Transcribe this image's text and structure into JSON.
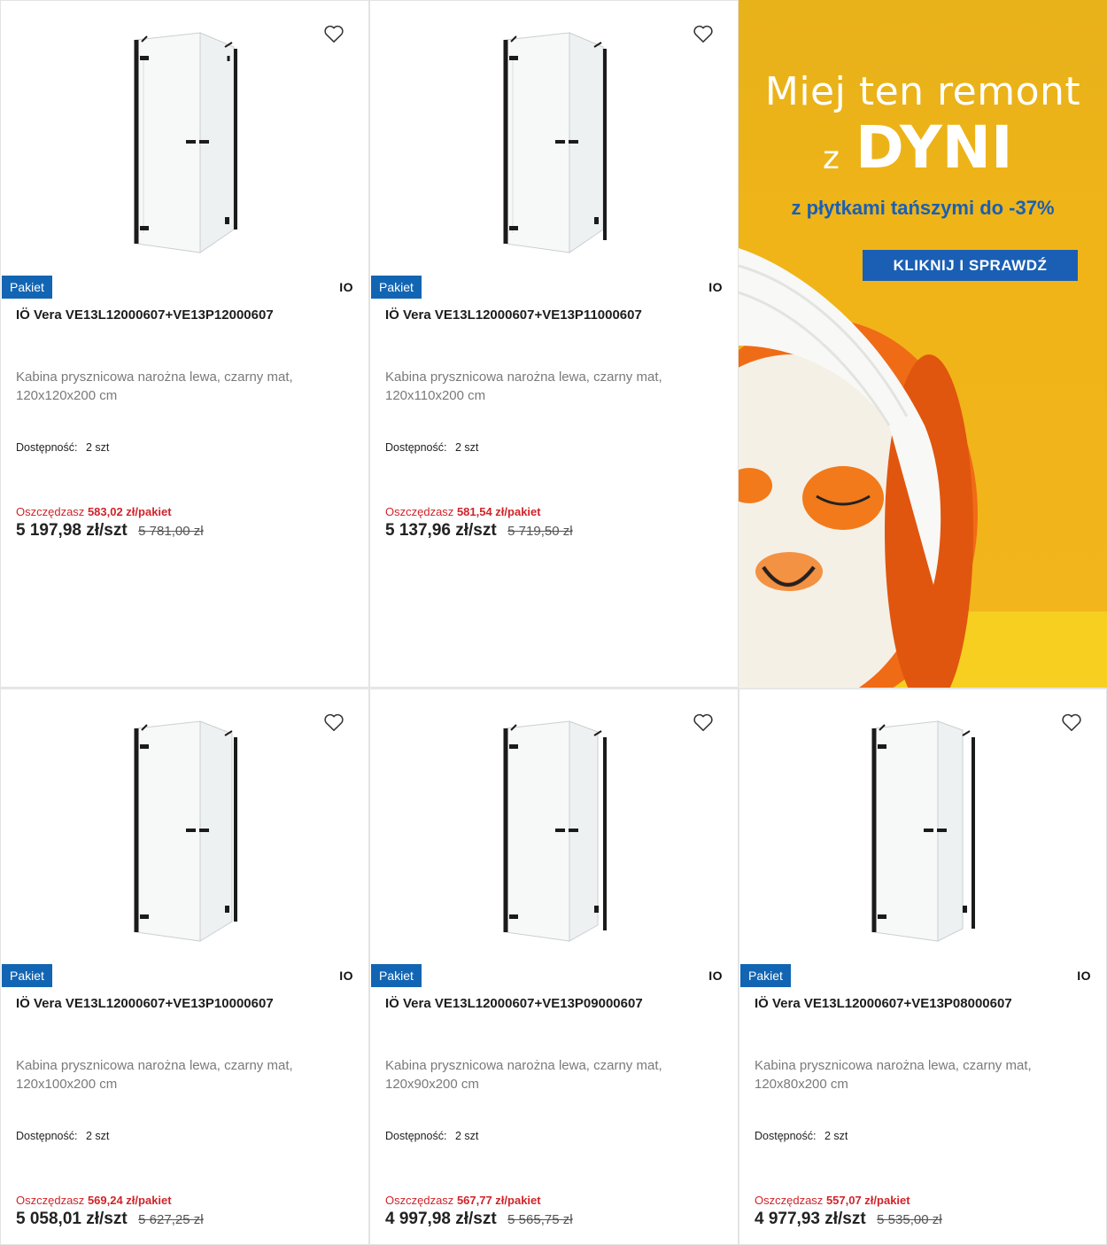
{
  "products": [
    {
      "badge": "Pakiet",
      "brand": "IO",
      "title": "IÖ Vera VE13L12000607+VE13P12000607",
      "description": "Kabina prysznicowa narożna lewa, czarny mat, 120x120x200 cm",
      "availability_label": "Dostępność:",
      "availability_value": "2 szt",
      "save_label": "Oszczędzasz",
      "save_amount": "583,02 zł/pakiet",
      "price": "5 197,98 zł/szt",
      "old_price": "5 781,00 zł"
    },
    {
      "badge": "Pakiet",
      "brand": "IO",
      "title": "IÖ Vera VE13L12000607+VE13P11000607",
      "description": "Kabina prysznicowa narożna lewa, czarny mat, 120x110x200 cm",
      "availability_label": "Dostępność:",
      "availability_value": "2 szt",
      "save_label": "Oszczędzasz",
      "save_amount": "581,54 zł/pakiet",
      "price": "5 137,96 zł/szt",
      "old_price": "5 719,50 zł"
    },
    {
      "badge": "Pakiet",
      "brand": "IO",
      "title": "IÖ Vera VE13L12000607+VE13P10000607",
      "description": "Kabina prysznicowa narożna lewa, czarny mat, 120x100x200 cm",
      "availability_label": "Dostępność:",
      "availability_value": "2 szt",
      "save_label": "Oszczędzasz",
      "save_amount": "569,24 zł/pakiet",
      "price": "5 058,01 zł/szt",
      "old_price": "5 627,25 zł"
    },
    {
      "badge": "Pakiet",
      "brand": "IO",
      "title": "IÖ Vera VE13L12000607+VE13P09000607",
      "description": "Kabina prysznicowa narożna lewa, czarny mat, 120x90x200 cm",
      "availability_label": "Dostępność:",
      "availability_value": "2 szt",
      "save_label": "Oszczędzasz",
      "save_amount": "567,77 zł/pakiet",
      "price": "4 997,98 zł/szt",
      "old_price": "5 565,75 zł"
    },
    {
      "badge": "Pakiet",
      "brand": "IO",
      "title": "IÖ Vera VE13L12000607+VE13P08000607",
      "description": "Kabina prysznicowa narożna lewa, czarny mat, 120x80x200 cm",
      "availability_label": "Dostępność:",
      "availability_value": "2 szt",
      "save_label": "Oszczędzasz",
      "save_amount": "557,07 zł/pakiet",
      "price": "4 977,93 zł/szt",
      "old_price": "5 535,00 zł"
    }
  ],
  "banner": {
    "headline": "Miej ten remont",
    "z": "z",
    "dyni": "DYNI",
    "subline": "z płytkami tańszymi do -37%",
    "cta": "KLIKNIJ I SPRAWDŹ"
  },
  "colors": {
    "badge": "#1265b3",
    "savings": "#d0242a",
    "banner_bg": "#f0b418",
    "banner_accent": "#1a5fb4"
  },
  "icons": {
    "favorite": "heart-outline-icon"
  }
}
